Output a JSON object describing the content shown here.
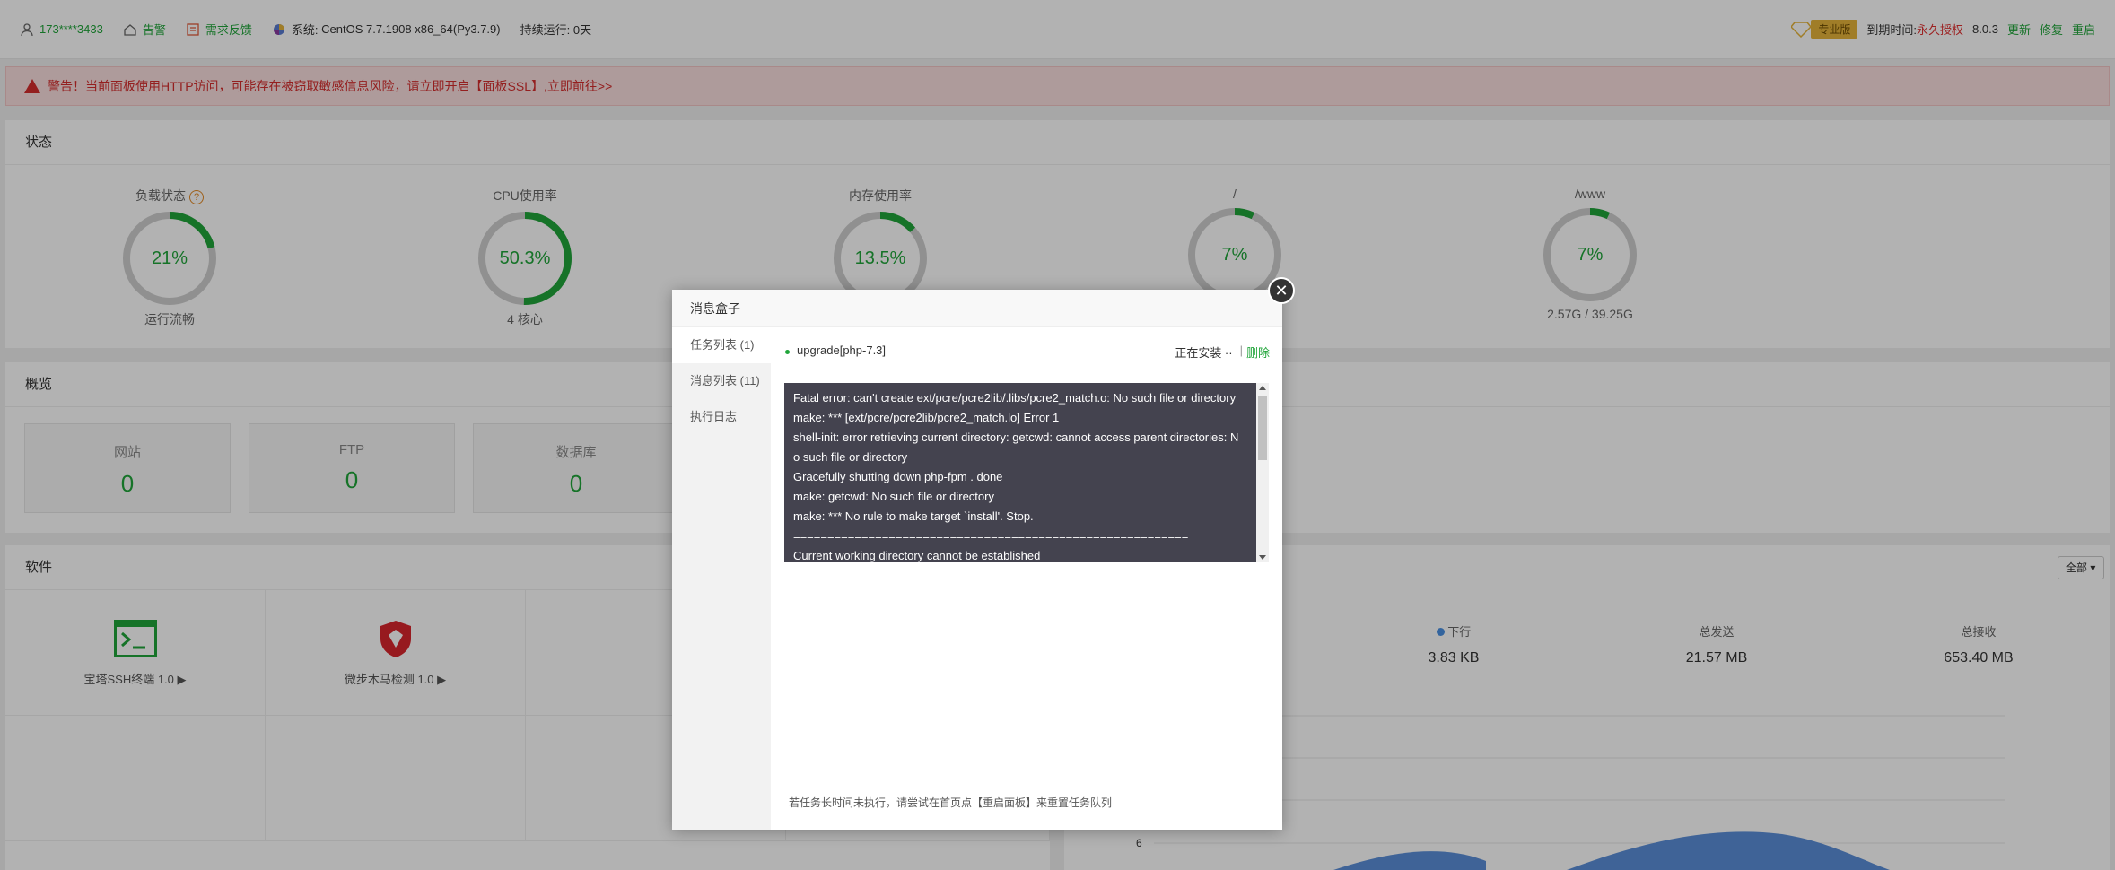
{
  "topbar": {
    "user": "173****3433",
    "alarm": "告警",
    "feedback": "需求反馈",
    "system_label": "系统:",
    "system": "CentOS 7.7.1908 x86_64(Py3.7.9)",
    "uptime": "持续运行: 0天",
    "edition": "专业版",
    "expire_label": "到期时间:",
    "expire_value": "永久授权",
    "version": "8.0.3",
    "update": "更新",
    "repair": "修复",
    "restart": "重启"
  },
  "warning": {
    "text": "警告！当前面板使用HTTP访问，可能存在被窃取敏感信息风险，请立即开启【面板SSL】,",
    "link": "立即前往>>"
  },
  "status": {
    "title": "状态",
    "gauges": [
      {
        "label": "负载状态",
        "value": "21%",
        "sub": "运行流畅",
        "pct": 0.21
      },
      {
        "label": "CPU使用率",
        "value": "50.3%",
        "sub": "4 核心",
        "pct": 0.503
      },
      {
        "label": "内存使用率",
        "value": "13.5%",
        "sub": "",
        "pct": 0.135
      },
      {
        "label": "/",
        "value": "7%",
        "sub": "",
        "pct": 0.07
      },
      {
        "label": "/www",
        "value": "7%",
        "sub": "2.57G / 39.25G",
        "pct": 0.07
      }
    ]
  },
  "overview": {
    "title": "概览",
    "boxes": [
      {
        "label": "网站",
        "count": "0"
      },
      {
        "label": "FTP",
        "count": "0"
      },
      {
        "label": "数据库",
        "count": "0"
      }
    ]
  },
  "software": {
    "title": "软件",
    "items": [
      {
        "name": "宝塔SSH终端 1.0 ▶"
      },
      {
        "name": "微步木马检测 1.0 ▶"
      }
    ],
    "dropdown": "全部"
  },
  "traffic": {
    "stats": [
      {
        "label": "下行",
        "value": "3.83 KB"
      },
      {
        "label": "总发送",
        "value": "21.57 MB"
      },
      {
        "label": "总接收",
        "value": "653.40 MB"
      }
    ],
    "axis_label": "6"
  },
  "modal": {
    "title": "消息盒子",
    "tabs": [
      "任务列表 (1)",
      "消息列表 (11)",
      "执行日志"
    ],
    "task_name": "upgrade[php-7.3]",
    "task_status": "正在安装 ··",
    "task_delete": "删除",
    "console_lines": [
      "Fatal error: can't create ext/pcre/pcre2lib/.libs/pcre2_match.o: No such file or directory",
      "make: *** [ext/pcre/pcre2lib/pcre2_match.lo] Error 1",
      "shell-init: error retrieving current directory: getcwd: cannot access parent directories: N",
      "o such file or directory",
      "Gracefully shutting down php-fpm . done",
      "make: getcwd: No such file or directory",
      "make: *** No rule to make target `install'. Stop.",
      "==========================================================",
      "Current working directory cannot be established"
    ],
    "tip": "若任务长时间未执行，请尝试在首页点【重启面板】来重置任务队列"
  }
}
